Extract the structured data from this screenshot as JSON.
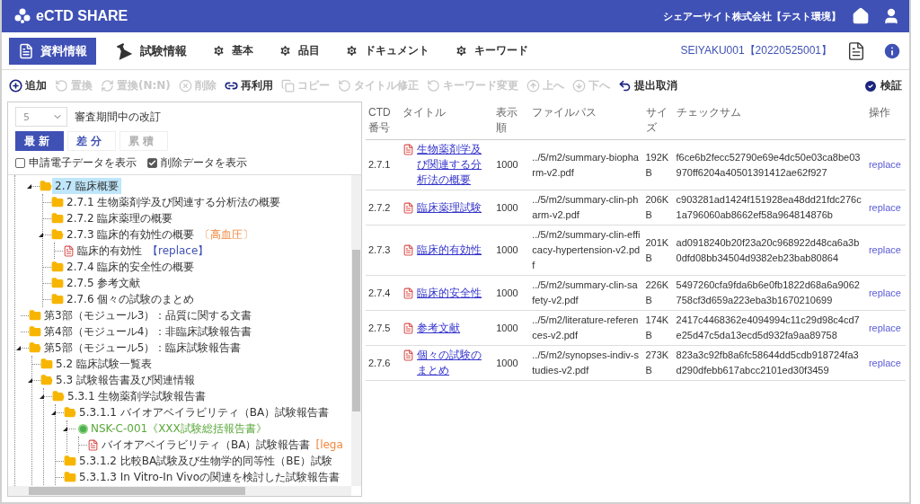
{
  "header": {
    "app_name": "eCTD SHARE",
    "company": "シェアーサイト株式会社【テスト環境】"
  },
  "nav": {
    "tabs": [
      {
        "label": "資料情報",
        "selected": true
      },
      {
        "label": "試験情報",
        "selected": false
      },
      {
        "label": "基本",
        "selected": false
      },
      {
        "label": "品目",
        "selected": false
      },
      {
        "label": "ドキュメント",
        "selected": false
      },
      {
        "label": "キーワード",
        "selected": false
      }
    ],
    "document_id": "SEIYAKU001【20220525001】"
  },
  "toolbar": {
    "actions": [
      {
        "label": "追加",
        "disabled": false
      },
      {
        "label": "置換",
        "disabled": true
      },
      {
        "label": "置換(N:N)",
        "disabled": true
      },
      {
        "label": "削除",
        "disabled": true
      },
      {
        "label": "再利用",
        "disabled": false
      },
      {
        "label": "コピー",
        "disabled": true
      },
      {
        "label": "タイトル修正",
        "disabled": true
      },
      {
        "label": "キーワード変更",
        "disabled": true
      },
      {
        "label": "上へ",
        "disabled": true
      },
      {
        "label": "下へ",
        "disabled": true
      },
      {
        "label": "提出取消",
        "disabled": false
      }
    ],
    "verify": {
      "label": "検証",
      "disabled": false
    }
  },
  "filter": {
    "version": "5",
    "version_label": "審査期間中の改訂",
    "modes": [
      {
        "label": "最新",
        "selected": true,
        "disabled": false
      },
      {
        "label": "差分",
        "selected": false,
        "disabled": false
      },
      {
        "label": "累積",
        "selected": false,
        "disabled": true
      }
    ],
    "checkboxes": [
      {
        "label": "申請電子データを表示",
        "checked": false
      },
      {
        "label": "削除データを表示",
        "checked": true
      }
    ]
  },
  "tree": {
    "continued_items": [
      {
        "kind": "folder",
        "label": "2.7 臨床概要",
        "expanded": true,
        "selected": true,
        "children": [
          {
            "kind": "folder",
            "label": "2.7.1 生物薬剤学及び関連する分析法の概要",
            "expanded": false,
            "selected": false
          },
          {
            "kind": "folder",
            "label": "2.7.2 臨床薬理の概要",
            "expanded": false,
            "selected": false
          },
          {
            "kind": "folder",
            "label": "2.7.3 臨床的有効性の概要",
            "expanded": true,
            "selected": false,
            "tag": {
              "text": "〔高血圧〕",
              "kind": "note"
            },
            "children": [
              {
                "kind": "file",
                "label": "臨床的有効性",
                "selected": false,
                "tag": {
                  "text": "【replace】",
                  "kind": "operation"
                }
              }
            ]
          },
          {
            "kind": "folder",
            "label": "2.7.4 臨床的安全性の概要",
            "expanded": false,
            "selected": false
          },
          {
            "kind": "folder",
            "label": "2.7.5 参考文献",
            "expanded": false,
            "selected": false
          },
          {
            "kind": "folder",
            "label": "2.7.6 個々の試験のまとめ",
            "expanded": false,
            "selected": false
          }
        ]
      }
    ],
    "items": [
      {
        "kind": "folder",
        "label": "第3部（モジュール3）：品質に関する文書",
        "expanded": false,
        "selected": false
      },
      {
        "kind": "folder",
        "label": "第4部（モジュール4）：非臨床試験報告書",
        "expanded": false,
        "selected": false
      },
      {
        "kind": "folder",
        "label": "第5部（モジュール5）：臨床試験報告書",
        "expanded": true,
        "selected": false,
        "children": [
          {
            "kind": "folder",
            "label": "5.2 臨床試験一覧表",
            "expanded": false,
            "selected": false
          },
          {
            "kind": "folder",
            "label": "5.3 試験報告書及び関連情報",
            "expanded": true,
            "selected": false,
            "children": [
              {
                "kind": "folder",
                "label": "5.3.1 生物薬剤学試験報告書",
                "expanded": true,
                "selected": false,
                "children": [
                  {
                    "kind": "folder",
                    "label": "5.3.1.1 バイオアベイラビリティ（BA）試験報告書",
                    "expanded": true,
                    "selected": false,
                    "children": [
                      {
                        "kind": "study",
                        "label": "NSK-C-001《XXX試験総括報告書》",
                        "expanded": true,
                        "selected": false,
                        "children": [
                          {
                            "kind": "file",
                            "label": "バイオアベイラビリティ（BA）試験報告書",
                            "selected": false,
                            "tag": {
                              "text": "[lega",
                              "kind": "note"
                            }
                          }
                        ]
                      }
                    ]
                  },
                  {
                    "kind": "folder",
                    "label": "5.3.1.2 比較BA試験及び生物学的同等性（BE）試験",
                    "expanded": false,
                    "selected": false
                  },
                  {
                    "kind": "folder",
                    "label": "5.3.1.3 In Vitro-In Vivoの関連を検討した試験報告書",
                    "expanded": false,
                    "selected": false
                  }
                ]
              }
            ]
          }
        ]
      }
    ]
  },
  "table": {
    "columns": [
      "CTD番号",
      "タイトル",
      "表示順",
      "ファイルパス",
      "サイズ",
      "チェックサム",
      "操作"
    ],
    "rows": [
      {
        "ctd": "2.7.1",
        "title": "生物薬剤学及び関連する分析法の概要",
        "order": "1000",
        "path": "../5/m2/summary-biopharm-v2.pdf",
        "size": "192KB",
        "checksum": "f6ce6b2fecc52790e69e4dc50e03ca8be03970ff6204a40501391412ae62f927",
        "action": "replace"
      },
      {
        "ctd": "2.7.2",
        "title": "臨床薬理試験",
        "order": "1000",
        "path": "../5/m2/summary-clin-pharm-v2.pdf",
        "size": "206KB",
        "checksum": "c903281ad1424f151928ea48dd21fdc276c1a796060ab8662ef58a964814876b",
        "action": "replace"
      },
      {
        "ctd": "2.7.3",
        "title": "臨床的有効性",
        "order": "1000",
        "path": "../5/m2/summary-clin-efficacy-hypertension-v2.pdf",
        "size": "201KB",
        "checksum": "ad0918240b20f23a20c968922d48ca6a3b0dfd08bb34504d9382eb23bab80864",
        "action": "replace"
      },
      {
        "ctd": "2.7.4",
        "title": "臨床的安全性",
        "order": "1000",
        "path": "../5/m2/summary-clin-safety-v2.pdf",
        "size": "226KB",
        "checksum": "5497260cfa9fda6b6e0fb1822d68a6a9062758cf3d659a223eba3b1670210699",
        "action": "replace"
      },
      {
        "ctd": "2.7.5",
        "title": "参考文献",
        "order": "1000",
        "path": "../5/m2/literature-references-v2.pdf",
        "size": "174KB",
        "checksum": "2417c4468362e4094994c11c29d98c4cd7e25d47c5da13ecd5d932fa9aa89758",
        "action": "replace"
      },
      {
        "ctd": "2.7.6",
        "title": "個々の試験のまとめ",
        "order": "1000",
        "path": "../5/m2/synopses-indiv-studies-v2.pdf",
        "size": "273KB",
        "checksum": "823a3c92fb8a6fc58644dd5cdb918724fa3d290dfebb617abcc2101ed30f3459",
        "action": "replace"
      }
    ]
  }
}
